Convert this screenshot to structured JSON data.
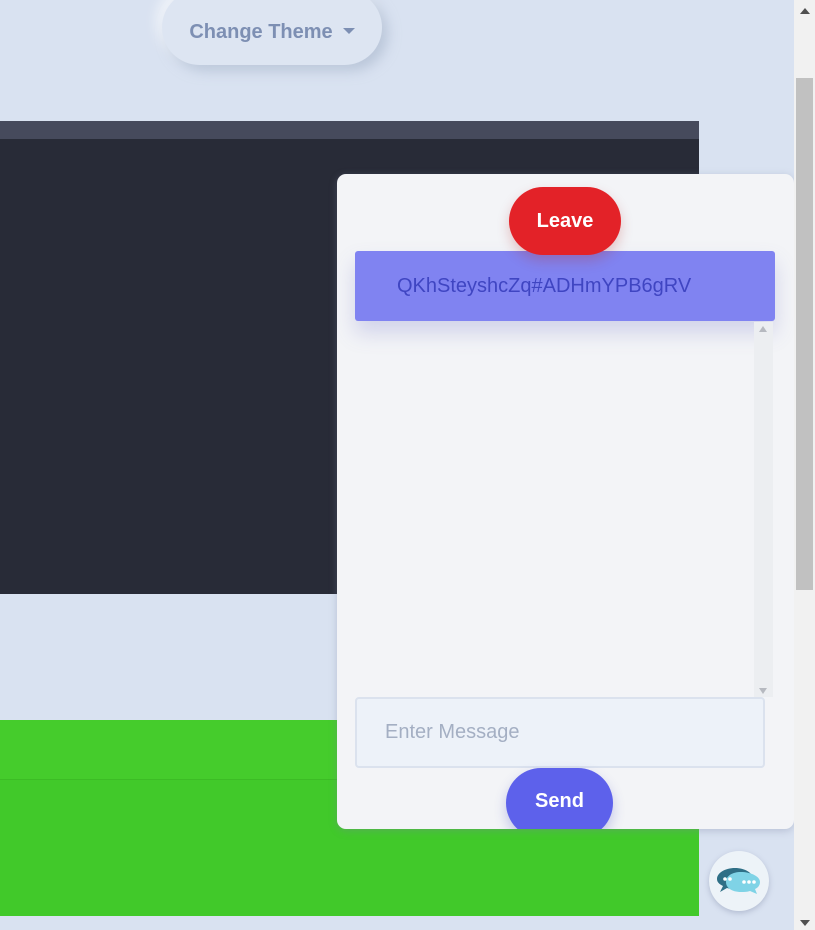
{
  "header": {
    "theme_button_label": "Change Theme",
    "theme_caret_icon": "caret-down-icon"
  },
  "colors": {
    "page_background": "#d9e2f1",
    "editor_background": "#282b37",
    "editor_header": "#464a5c",
    "green_panel": "#45cc2c",
    "leave": "#e32228",
    "room_id_background": "#8083f1",
    "send": "#5d61eb"
  },
  "chat": {
    "leave_label": "Leave",
    "room_id": "QKhSteyshcZq#ADHmYPB6gRV",
    "messages": [],
    "message_placeholder": "Enter Message",
    "message_value": "",
    "send_label": "Send"
  },
  "fab": {
    "icon": "chat-bubbles-icon"
  }
}
